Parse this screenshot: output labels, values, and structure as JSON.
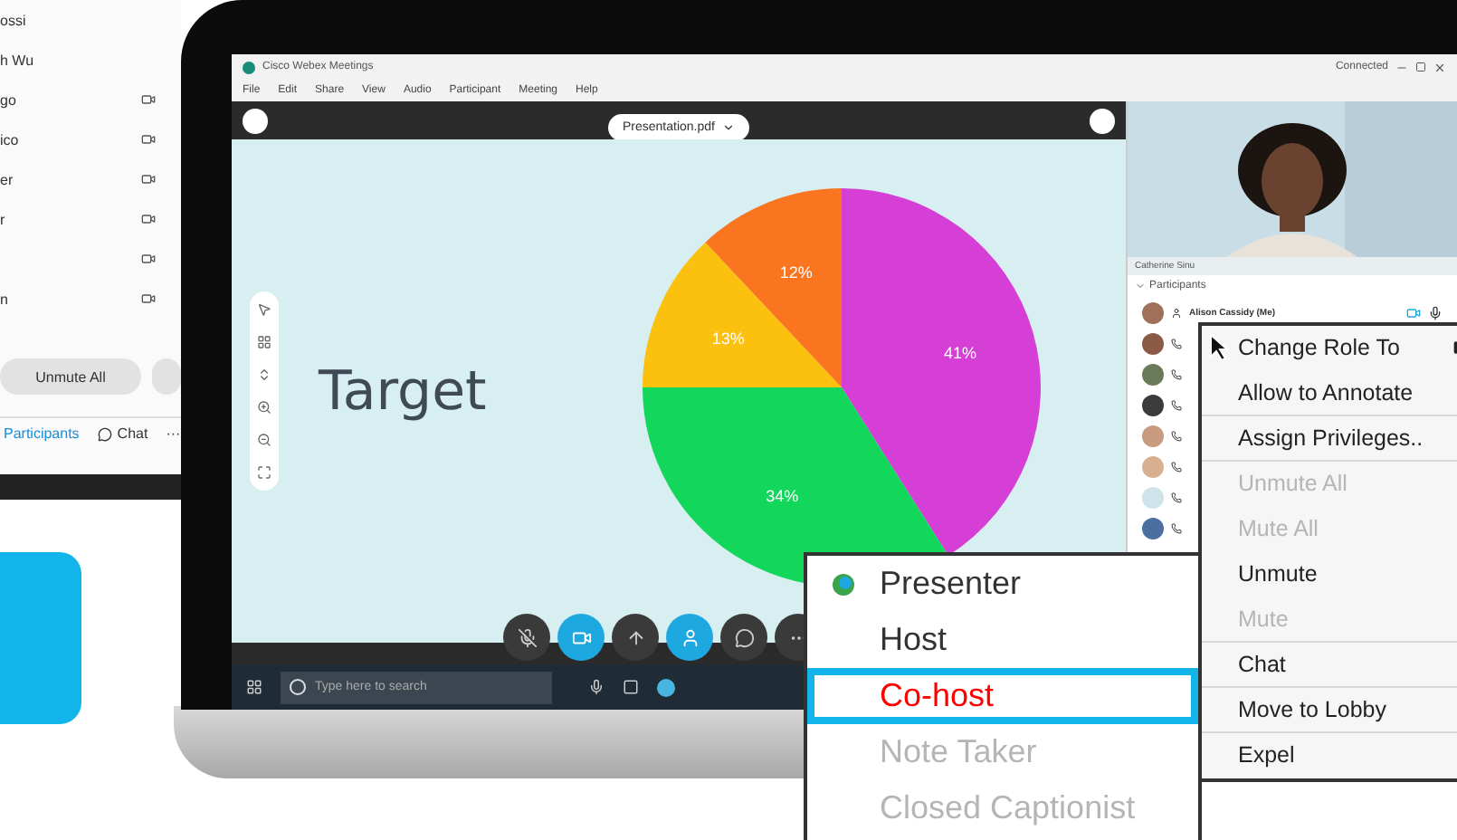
{
  "back_panel": {
    "rows": [
      {
        "name": "ossi",
        "camera": false
      },
      {
        "name": "h Wu",
        "camera": false
      },
      {
        "name": "go",
        "camera": true
      },
      {
        "name": "ico",
        "camera": true
      },
      {
        "name": "er",
        "camera": true
      },
      {
        "name": "r",
        "camera": true
      },
      {
        "camera": true
      },
      {
        "name": "n",
        "camera": true
      }
    ],
    "button": "Unmute All",
    "tabs": [
      {
        "label": "Participants",
        "selected": true
      },
      {
        "label": "Chat",
        "selected": false
      }
    ],
    "more": "···"
  },
  "window": {
    "title": "Cisco Webex Meetings",
    "status": "Connected",
    "menu": [
      "File",
      "Edit",
      "Share",
      "View",
      "Audio",
      "Participant",
      "Meeting",
      "Help"
    ]
  },
  "document": {
    "name": "Presentation.pdf"
  },
  "slide": {
    "title": "Target",
    "chart_data": {
      "type": "pie",
      "values": [
        41,
        34,
        13,
        12
      ],
      "colors": [
        "#d63fd6",
        "#12d75a",
        "#fbc10e",
        "#fb7521"
      ],
      "value_labels": [
        "41%",
        "34%",
        "13%",
        "12%"
      ]
    }
  },
  "video": {
    "name": "Catherine Sinu"
  },
  "participants": {
    "title": "Participants",
    "me": "Alison Cassidy (Me)"
  },
  "taskbar": {
    "placeholder": "Type here to search"
  },
  "context_menu": [
    {
      "label": "Change Role To",
      "disabled": false,
      "submenu": true
    },
    {
      "label": "Allow to Annotate",
      "disabled": false,
      "separator": true
    },
    {
      "label": "Assign Privileges..",
      "disabled": false,
      "separator": true
    },
    {
      "label": "Unmute All",
      "disabled": true
    },
    {
      "label": "Mute All",
      "disabled": true
    },
    {
      "label": "Unmute",
      "disabled": false
    },
    {
      "label": "Mute",
      "disabled": true,
      "separator": true
    },
    {
      "label": "Chat",
      "disabled": false,
      "separator": true
    },
    {
      "label": "Move to Lobby",
      "disabled": false,
      "separator": true
    },
    {
      "label": "Expel",
      "disabled": false
    }
  ],
  "role_menu": [
    {
      "label": "Presenter",
      "disabled": false,
      "selected": false,
      "icon": true
    },
    {
      "label": "Host",
      "disabled": false,
      "selected": false
    },
    {
      "label": "Co-host",
      "disabled": false,
      "selected": true
    },
    {
      "label": "Note Taker",
      "disabled": true,
      "selected": false
    },
    {
      "label": "Closed Captionist",
      "disabled": true,
      "selected": false
    }
  ]
}
